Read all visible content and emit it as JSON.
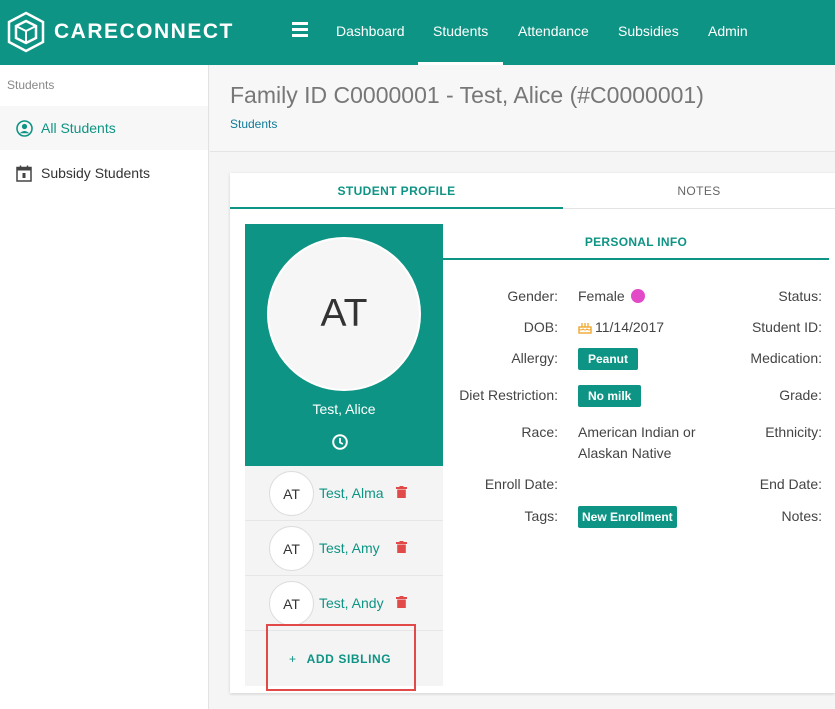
{
  "app": {
    "brand": "CARECONNECT",
    "nav": [
      "Dashboard",
      "Students",
      "Attendance",
      "Subsidies",
      "Admin"
    ],
    "active_nav": "Students"
  },
  "sidebar": {
    "heading": "Students",
    "items": [
      {
        "label": "All Students",
        "icon": "person-circle-icon",
        "active": true
      },
      {
        "label": "Subsidy Students",
        "icon": "calendar-icon",
        "active": false
      }
    ]
  },
  "header": {
    "title": "Family ID C0000001 - Test, Alice (#C0000001)",
    "breadcrumb": "Students"
  },
  "tabs": [
    "STUDENT PROFILE",
    "NOTES"
  ],
  "profile": {
    "initials": "AT",
    "name": "Test, Alice",
    "history_icon": "clock-icon"
  },
  "siblings": [
    {
      "initials": "AT",
      "name": "Test, Alma"
    },
    {
      "initials": "AT",
      "name": "Test, Amy"
    },
    {
      "initials": "AT",
      "name": "Test, Andy"
    }
  ],
  "add_sibling": {
    "icon": "+",
    "label": "ADD SIBLING"
  },
  "personal_info": {
    "tab": "PERSONAL INFO",
    "labels": {
      "gender": "Gender:",
      "dob": "DOB:",
      "allergy": "Allergy:",
      "diet": "Diet Restriction:",
      "race": "Race:",
      "enroll": "Enroll Date:",
      "tags": "Tags:",
      "status": "Status:",
      "student_id": "Student ID:",
      "medication": "Medication:",
      "grade": "Grade:",
      "ethnicity": "Ethnicity:",
      "end_date": "End Date:",
      "notes": "Notes:"
    },
    "values": {
      "gender": "Female",
      "dob": "11/14/2017",
      "allergy": "Peanut",
      "diet": "No milk",
      "race_line1": "American Indian or",
      "race_line2": "Alaskan Native",
      "tag": "New Enrollment"
    }
  },
  "colors": {
    "primary": "#0e9484",
    "danger": "#e24a4a",
    "gender_female": "#e24ac7",
    "cake": "#f0a830"
  }
}
